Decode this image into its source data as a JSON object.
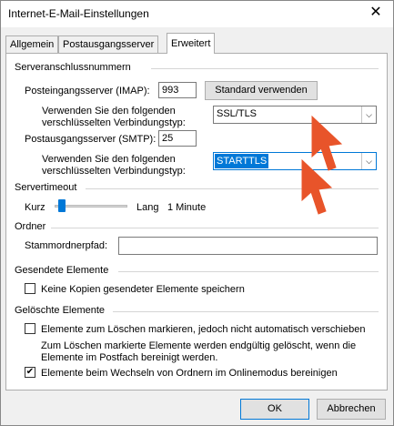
{
  "window": {
    "title": "Internet-E-Mail-Einstellungen",
    "close_symbol": "✕"
  },
  "tabs": [
    {
      "label": "Allgemein"
    },
    {
      "label": "Postausgangsserver"
    },
    {
      "label": "Erweitert",
      "active": true
    }
  ],
  "server_ports": {
    "section_title": "Serveranschlussnummern",
    "incoming_label": "Posteingangsserver (IMAP):",
    "incoming_value": "993",
    "default_button": "Standard verwenden",
    "encryption_label_line1": "Verwenden Sie den folgenden",
    "encryption_label_line2": "verschlüsselten Verbindungstyp:",
    "incoming_encryption": "SSL/TLS",
    "outgoing_label": "Postausgangsserver (SMTP):",
    "outgoing_value": "25",
    "outgoing_encryption": "STARTTLS"
  },
  "timeout": {
    "section_title": "Servertimeout",
    "short_label": "Kurz",
    "long_label": "Lang",
    "value_text": "1 Minute",
    "level": 0.05
  },
  "folders": {
    "section_title": "Ordner",
    "root_label": "Stammordnerpfad:",
    "root_value": ""
  },
  "sent_items": {
    "section_title": "Gesendete Elemente",
    "no_copies_label": "Keine Kopien gesendeter Elemente speichern",
    "no_copies_checked": false
  },
  "deleted_items": {
    "section_title": "Gelöschte Elemente",
    "mark_label": "Elemente zum Löschen markieren, jedoch nicht automatisch verschieben",
    "mark_checked": false,
    "description_line1": "Zum Löschen markierte Elemente werden endgültig gelöscht, wenn die",
    "description_line2": "Elemente im Postfach bereinigt werden.",
    "purge_label": "Elemente beim Wechseln von Ordnern im Onlinemodus bereinigen",
    "purge_checked": true,
    "check_symbol": "✔"
  },
  "footer": {
    "ok": "OK",
    "cancel": "Abbrechen"
  },
  "annotation_color": "#e8542a"
}
